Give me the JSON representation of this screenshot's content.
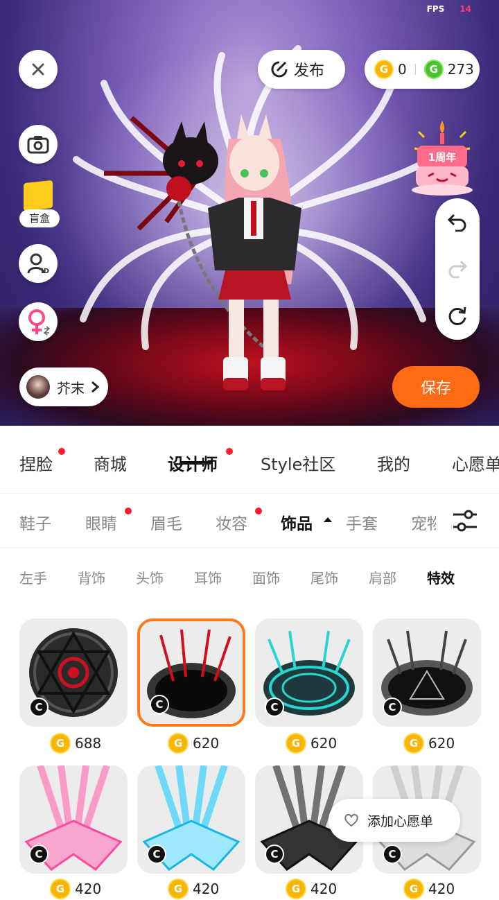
{
  "status": {
    "fps_label": "FPS",
    "fps_value": "14"
  },
  "top": {
    "publish_label": "发布",
    "gold_coins": "0",
    "green_coins": "273",
    "blindbox_label": "盲盒",
    "user_name": "芥末",
    "save_label": "保存",
    "anniversary_badge": "1周年"
  },
  "main_tabs": [
    {
      "label": "捏脸",
      "dot": true
    },
    {
      "label": "商城",
      "dot": false
    },
    {
      "label": "设计师",
      "dot": true,
      "active": true
    },
    {
      "label": "Style社区",
      "dot": false
    },
    {
      "label": "我的",
      "dot": false
    },
    {
      "label": "心愿单",
      "dot": false
    }
  ],
  "sub_tabs": [
    {
      "label": "鞋子",
      "dot": false
    },
    {
      "label": "眼睛",
      "dot": true
    },
    {
      "label": "眉毛",
      "dot": false
    },
    {
      "label": "妆容",
      "dot": true
    },
    {
      "label": "饰品",
      "dot": false,
      "active": true
    },
    {
      "label": "手套",
      "dot": false
    },
    {
      "label": "宠物",
      "dot": false
    }
  ],
  "third_tabs": [
    "左手",
    "背饰",
    "头饰",
    "耳饰",
    "面饰",
    "尾饰",
    "肩部",
    "特效"
  ],
  "items": [
    {
      "price": "688",
      "badge": "C",
      "theme": "red-circle"
    },
    {
      "price": "620",
      "badge": "C",
      "theme": "dark-portal",
      "selected": true
    },
    {
      "price": "620",
      "badge": "C",
      "theme": "cyan-circle"
    },
    {
      "price": "620",
      "badge": "C",
      "theme": "white-circle"
    },
    {
      "price": "420",
      "badge": "C",
      "theme": "pink-star"
    },
    {
      "price": "420",
      "badge": "C",
      "theme": "blue-star"
    },
    {
      "price": "420",
      "badge": "C",
      "theme": "black-star"
    },
    {
      "price": "420",
      "badge": "C",
      "theme": "silver-star"
    }
  ],
  "wish_label": "添加心愿单",
  "colors": {
    "accent": "#ff6a14",
    "dot": "#ff1b2d",
    "gold": "#f7b500",
    "green": "#4ac22e"
  }
}
